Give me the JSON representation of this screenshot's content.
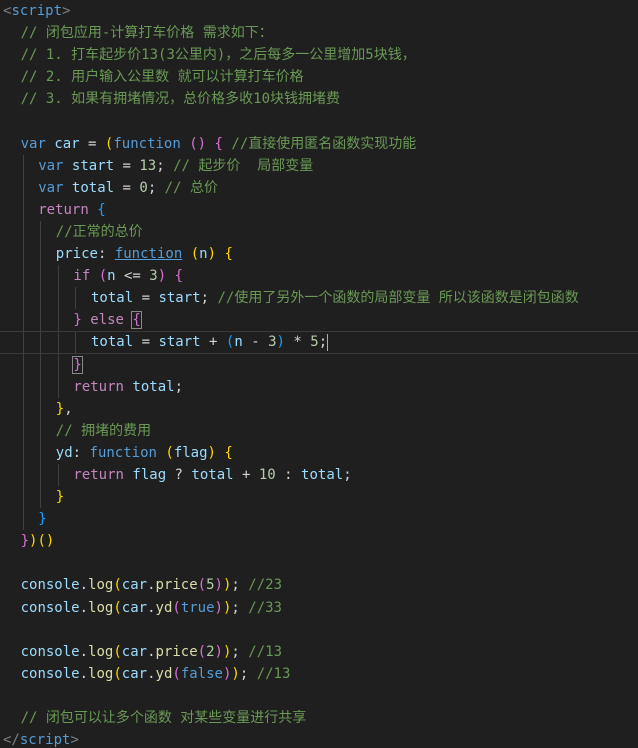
{
  "editor": {
    "language": "javascript",
    "lines": [
      {
        "indent": 0,
        "tokens": [
          [
            "tagbr",
            "<"
          ],
          [
            "tag",
            "script"
          ],
          [
            "tagbr",
            ">"
          ]
        ]
      },
      {
        "indent": 1,
        "tokens": [
          [
            "cmt",
            "// 闭包应用-计算打车价格 需求如下："
          ]
        ]
      },
      {
        "indent": 1,
        "tokens": [
          [
            "cmt",
            "// 1. 打车起步价13(3公里内)，之后每多一公里增加5块钱，"
          ]
        ]
      },
      {
        "indent": 1,
        "tokens": [
          [
            "cmt",
            "// 2. 用户输入公里数 就可以计算打车价格"
          ]
        ]
      },
      {
        "indent": 1,
        "tokens": [
          [
            "cmt",
            "// 3. 如果有拥堵情况，总价格多收10块钱拥堵费"
          ]
        ]
      },
      {
        "indent": 0,
        "tokens": []
      },
      {
        "indent": 1,
        "tokens": [
          [
            "kw",
            "var"
          ],
          [
            "op",
            " "
          ],
          [
            "var",
            "car"
          ],
          [
            "op",
            " = "
          ],
          [
            "p1",
            "("
          ],
          [
            "kw",
            "function"
          ],
          [
            "op",
            " "
          ],
          [
            "p2",
            "()"
          ],
          [
            "op",
            " "
          ],
          [
            "p2",
            "{"
          ],
          [
            "op",
            " "
          ],
          [
            "cmt",
            "//直接使用匿名函数实现功能"
          ]
        ]
      },
      {
        "indent": 2,
        "tokens": [
          [
            "kw",
            "var"
          ],
          [
            "op",
            " "
          ],
          [
            "var",
            "start"
          ],
          [
            "op",
            " = "
          ],
          [
            "num",
            "13"
          ],
          [
            "op",
            "; "
          ],
          [
            "cmt",
            "// 起步价  局部变量"
          ]
        ]
      },
      {
        "indent": 2,
        "tokens": [
          [
            "kw",
            "var"
          ],
          [
            "op",
            " "
          ],
          [
            "var",
            "total"
          ],
          [
            "op",
            " = "
          ],
          [
            "num",
            "0"
          ],
          [
            "op",
            "; "
          ],
          [
            "cmt",
            "// 总价"
          ]
        ]
      },
      {
        "indent": 2,
        "tokens": [
          [
            "ctrl",
            "return"
          ],
          [
            "op",
            " "
          ],
          [
            "p3",
            "{"
          ]
        ]
      },
      {
        "indent": 3,
        "tokens": [
          [
            "cmt",
            "//正常的总价"
          ]
        ]
      },
      {
        "indent": 3,
        "tokens": [
          [
            "var",
            "price"
          ],
          [
            "op",
            ": "
          ],
          [
            "link",
            "function"
          ],
          [
            "op",
            " "
          ],
          [
            "p1",
            "("
          ],
          [
            "var",
            "n"
          ],
          [
            "p1",
            ")"
          ],
          [
            "op",
            " "
          ],
          [
            "p1",
            "{"
          ]
        ]
      },
      {
        "indent": 4,
        "tokens": [
          [
            "ctrl",
            "if"
          ],
          [
            "op",
            " "
          ],
          [
            "p2",
            "("
          ],
          [
            "var",
            "n"
          ],
          [
            "op",
            " <= "
          ],
          [
            "num",
            "3"
          ],
          [
            "p2",
            ")"
          ],
          [
            "op",
            " "
          ],
          [
            "p2",
            "{"
          ]
        ]
      },
      {
        "indent": 5,
        "tokens": [
          [
            "var",
            "total"
          ],
          [
            "op",
            " = "
          ],
          [
            "var",
            "start"
          ],
          [
            "op",
            "; "
          ],
          [
            "cmt",
            "//使用了另外一个函数的局部变量 所以该函数是闭包函数"
          ]
        ]
      },
      {
        "indent": 4,
        "tokens": [
          [
            "p2",
            "}"
          ],
          [
            "op",
            " "
          ],
          [
            "ctrl",
            "else"
          ],
          [
            "op",
            " "
          ],
          [
            "p2bm",
            "{"
          ]
        ]
      },
      {
        "indent": 5,
        "current": true,
        "tokens": [
          [
            "var",
            "total"
          ],
          [
            "op",
            " = "
          ],
          [
            "var",
            "start"
          ],
          [
            "op",
            " + "
          ],
          [
            "p3",
            "("
          ],
          [
            "var",
            "n"
          ],
          [
            "op",
            " - "
          ],
          [
            "num",
            "3"
          ],
          [
            "p3",
            ")"
          ],
          [
            "op",
            " * "
          ],
          [
            "num",
            "5"
          ],
          [
            "op",
            ";"
          ],
          [
            "cursor",
            ""
          ]
        ]
      },
      {
        "indent": 4,
        "tokens": [
          [
            "p2bm",
            "}"
          ]
        ]
      },
      {
        "indent": 4,
        "tokens": [
          [
            "ctrl",
            "return"
          ],
          [
            "op",
            " "
          ],
          [
            "var",
            "total"
          ],
          [
            "op",
            ";"
          ]
        ]
      },
      {
        "indent": 3,
        "tokens": [
          [
            "p1",
            "}"
          ],
          [
            "op",
            ","
          ]
        ]
      },
      {
        "indent": 3,
        "tokens": [
          [
            "cmt",
            "// 拥堵的费用"
          ]
        ]
      },
      {
        "indent": 3,
        "tokens": [
          [
            "var",
            "yd"
          ],
          [
            "op",
            ": "
          ],
          [
            "kw",
            "function"
          ],
          [
            "op",
            " "
          ],
          [
            "p1",
            "("
          ],
          [
            "var",
            "flag"
          ],
          [
            "p1",
            ")"
          ],
          [
            "op",
            " "
          ],
          [
            "p1",
            "{"
          ]
        ]
      },
      {
        "indent": 4,
        "tokens": [
          [
            "ctrl",
            "return"
          ],
          [
            "op",
            " "
          ],
          [
            "var",
            "flag"
          ],
          [
            "op",
            " ? "
          ],
          [
            "var",
            "total"
          ],
          [
            "op",
            " + "
          ],
          [
            "num",
            "10"
          ],
          [
            "op",
            " : "
          ],
          [
            "var",
            "total"
          ],
          [
            "op",
            ";"
          ]
        ]
      },
      {
        "indent": 3,
        "tokens": [
          [
            "p1",
            "}"
          ]
        ]
      },
      {
        "indent": 2,
        "tokens": [
          [
            "p3",
            "}"
          ]
        ]
      },
      {
        "indent": 1,
        "tokens": [
          [
            "p2",
            "}"
          ],
          [
            "p1",
            ")"
          ],
          [
            "p1",
            "()"
          ]
        ]
      },
      {
        "indent": 0,
        "tokens": []
      },
      {
        "indent": 1,
        "tokens": [
          [
            "var",
            "console"
          ],
          [
            "op",
            "."
          ],
          [
            "fn",
            "log"
          ],
          [
            "p1",
            "("
          ],
          [
            "var",
            "car"
          ],
          [
            "op",
            "."
          ],
          [
            "fn",
            "price"
          ],
          [
            "p2",
            "("
          ],
          [
            "num",
            "5"
          ],
          [
            "p2",
            ")"
          ],
          [
            "p1",
            ")"
          ],
          [
            "op",
            "; "
          ],
          [
            "cmt",
            "//23"
          ]
        ]
      },
      {
        "indent": 1,
        "tokens": [
          [
            "var",
            "console"
          ],
          [
            "op",
            "."
          ],
          [
            "fn",
            "log"
          ],
          [
            "p1",
            "("
          ],
          [
            "var",
            "car"
          ],
          [
            "op",
            "."
          ],
          [
            "fn",
            "yd"
          ],
          [
            "p2",
            "("
          ],
          [
            "kw",
            "true"
          ],
          [
            "p2",
            ")"
          ],
          [
            "p1",
            ")"
          ],
          [
            "op",
            "; "
          ],
          [
            "cmt",
            "//33"
          ]
        ]
      },
      {
        "indent": 0,
        "tokens": []
      },
      {
        "indent": 1,
        "tokens": [
          [
            "var",
            "console"
          ],
          [
            "op",
            "."
          ],
          [
            "fn",
            "log"
          ],
          [
            "p1",
            "("
          ],
          [
            "var",
            "car"
          ],
          [
            "op",
            "."
          ],
          [
            "fn",
            "price"
          ],
          [
            "p2",
            "("
          ],
          [
            "num",
            "2"
          ],
          [
            "p2",
            ")"
          ],
          [
            "p1",
            ")"
          ],
          [
            "op",
            "; "
          ],
          [
            "cmt",
            "//13"
          ]
        ]
      },
      {
        "indent": 1,
        "tokens": [
          [
            "var",
            "console"
          ],
          [
            "op",
            "."
          ],
          [
            "fn",
            "log"
          ],
          [
            "p1",
            "("
          ],
          [
            "var",
            "car"
          ],
          [
            "op",
            "."
          ],
          [
            "fn",
            "yd"
          ],
          [
            "p2",
            "("
          ],
          [
            "kw",
            "false"
          ],
          [
            "p2",
            ")"
          ],
          [
            "p1",
            ")"
          ],
          [
            "op",
            "; "
          ],
          [
            "cmt",
            "//13"
          ]
        ]
      },
      {
        "indent": 0,
        "tokens": []
      },
      {
        "indent": 1,
        "tokens": [
          [
            "cmt",
            "// 闭包可以让多个函数 对某些变量进行共享"
          ]
        ]
      },
      {
        "indent": 0,
        "tokens": [
          [
            "tagbr",
            "</"
          ],
          [
            "tag",
            "script"
          ],
          [
            "tagbr",
            ">"
          ]
        ]
      }
    ]
  }
}
